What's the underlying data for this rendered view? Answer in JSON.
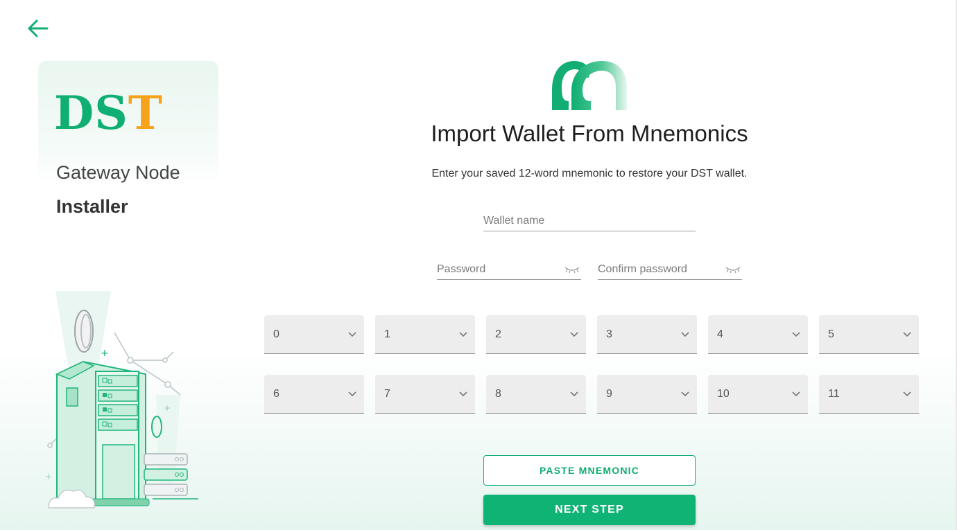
{
  "brand": {
    "logo_part_green": "DS",
    "logo_part_orange": "T",
    "subtitle_line1": "Gateway Node",
    "subtitle_line2": "Installer"
  },
  "main": {
    "title": "Import Wallet From Mnemonics",
    "description": "Enter your saved 12-word mnemonic to restore your DST wallet."
  },
  "form": {
    "wallet_name_placeholder": "Wallet name",
    "password_placeholder": "Password",
    "confirm_password_placeholder": "Confirm password"
  },
  "mnemonic_words": [
    "0",
    "1",
    "2",
    "3",
    "4",
    "5",
    "6",
    "7",
    "8",
    "9",
    "10",
    "11"
  ],
  "actions": {
    "paste_label": "PASTE MNEMONIC",
    "next_label": "NEXT STEP"
  },
  "colors": {
    "accent": "#0fae72",
    "brand_orange": "#f7a21b"
  },
  "icons": {
    "back": "arrow-left-icon",
    "password_toggle": "eye-closed-icon",
    "select": "chevron-down-icon"
  }
}
